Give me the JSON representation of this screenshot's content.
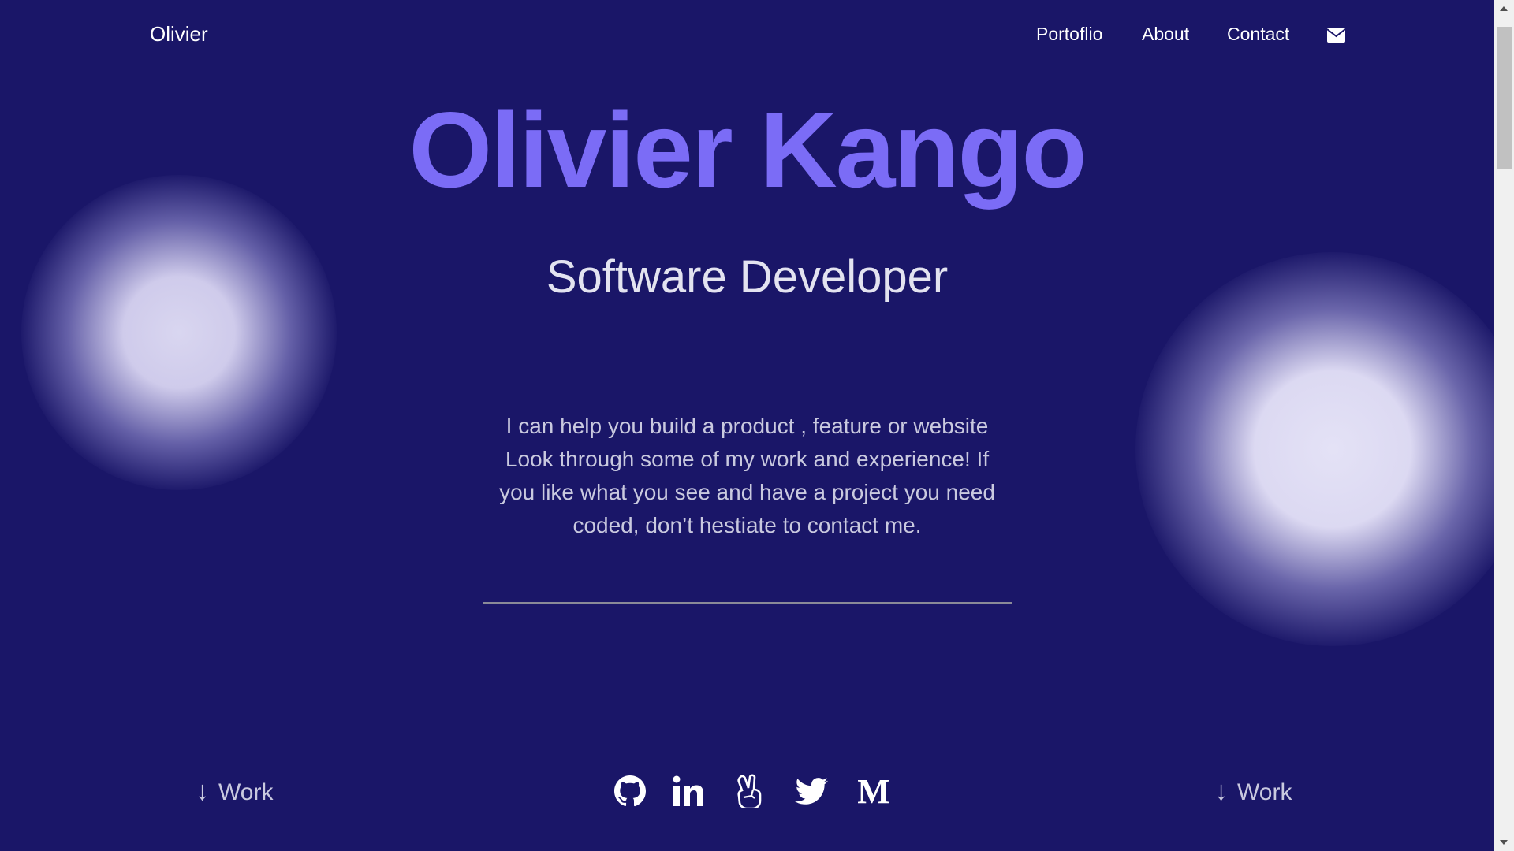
{
  "header": {
    "logo": "Olivier",
    "nav": [
      {
        "label": "Portoflio"
      },
      {
        "label": "About"
      },
      {
        "label": "Contact"
      }
    ],
    "mail_icon": "envelope-icon"
  },
  "hero": {
    "name": "Olivier Kango",
    "role": "Software Developer",
    "lines": [
      "I can help you build a product , feature or website",
      "Look through some of my work and experience! If",
      "you like what you see and have a project you need",
      "coded, don’t hestiate to contact me."
    ]
  },
  "footer": {
    "work_left": "Work",
    "work_right": "Work",
    "arrow": "↓",
    "socials": [
      "github-icon",
      "linkedin-icon",
      "peace-hand-icon",
      "twitter-icon",
      "medium-icon"
    ],
    "medium_letter": "M"
  },
  "colors": {
    "background": "#1a1668",
    "accent": "#7b6cf6"
  }
}
